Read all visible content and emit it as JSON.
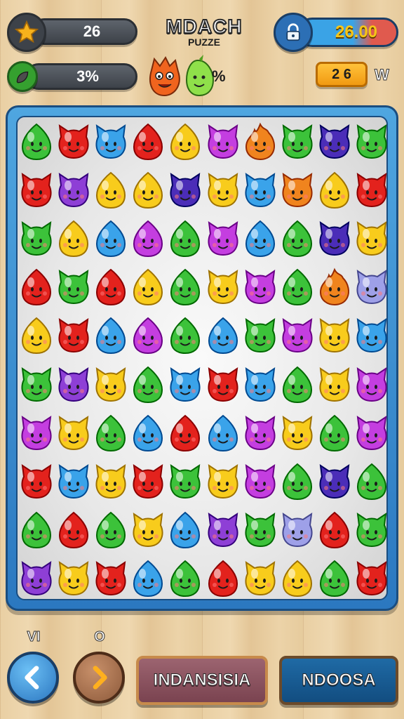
{
  "header": {
    "title_line1": "MDACH",
    "title_line2": "PUZZE",
    "score": "26",
    "percent": "3%",
    "mascot_percent": "%",
    "timer": "26.00",
    "coins": "2 6",
    "coins_suffix": "W"
  },
  "icons": {
    "score_badge": "star-icon",
    "percent_badge": "leaf-icon",
    "timer_badge": "lock-icon",
    "back": "chevron-left-icon",
    "next": "chevron-right-icon"
  },
  "colors": {
    "green": "#3cc23a",
    "red": "#e3221d",
    "blue": "#3aa3ea",
    "yellow": "#f8cc1c",
    "magenta": "#c43ee0",
    "purple": "#8e3fd6",
    "indigo": "#4b2db8",
    "orange": "#f0841e",
    "lavender": "#9ea0e8"
  },
  "board": {
    "rows": [
      [
        "G:o",
        "R:c",
        "B:c",
        "R:o",
        "Y:o",
        "M:c",
        "O:f",
        "G:c",
        "I:c",
        "G:c"
      ],
      [
        "R:c",
        "P:c",
        "Y:o",
        "Y:o",
        "I:c",
        "Y:c",
        "B:c",
        "O:c",
        "Y:o",
        "R:c"
      ],
      [
        "G:c",
        "Y:o",
        "B:o",
        "M:o",
        "G:o",
        "M:c",
        "B:o",
        "G:o",
        "I:c",
        "Y:c"
      ],
      [
        "R:o",
        "G:c",
        "R:o",
        "Y:o",
        "G:o",
        "Y:c",
        "M:c",
        "G:o",
        "O:f",
        "L:c"
      ],
      [
        "Y:o",
        "R:c",
        "B:o",
        "M:o",
        "G:o",
        "B:o",
        "G:c",
        "M:c",
        "Y:c",
        "B:c"
      ],
      [
        "G:c",
        "P:c",
        "Y:c",
        "G:o",
        "B:c",
        "R:c",
        "B:c",
        "G:o",
        "Y:c",
        "M:c"
      ],
      [
        "M:c",
        "Y:c",
        "G:o",
        "B:o",
        "R:o",
        "B:o",
        "M:c",
        "Y:c",
        "G:o",
        "M:c"
      ],
      [
        "R:c",
        "B:c",
        "Y:c",
        "R:c",
        "G:c",
        "Y:c",
        "M:c",
        "G:o",
        "I:c",
        "G:o"
      ],
      [
        "G:o",
        "R:o",
        "G:o",
        "Y:c",
        "B:o",
        "P:c",
        "G:c",
        "L:c",
        "R:o",
        "G:c"
      ],
      [
        "P:c",
        "Y:c",
        "R:c",
        "B:o",
        "G:o",
        "R:o",
        "Y:c",
        "Y:o",
        "G:o",
        "R:c"
      ]
    ]
  },
  "controls": {
    "back_caption": "VI",
    "next_caption": "O",
    "left_button": "INDANSISIA",
    "right_button": "NDOOSA"
  }
}
